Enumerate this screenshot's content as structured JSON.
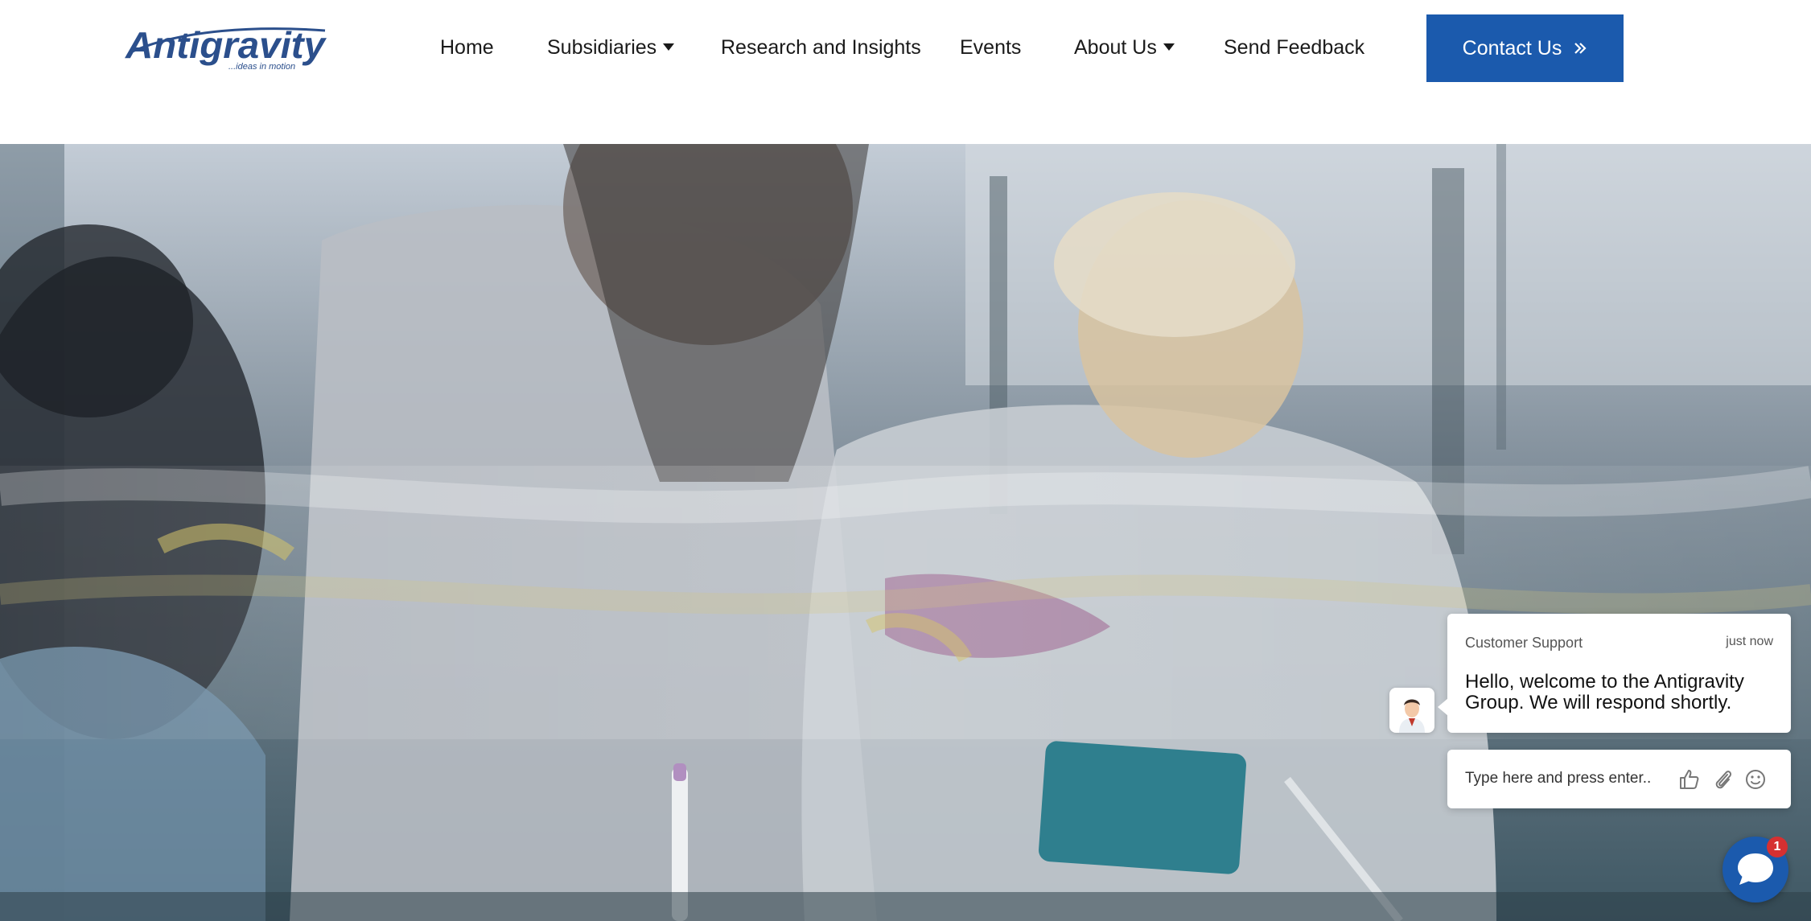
{
  "header": {
    "logo_text": "Antigravity",
    "logo_tagline": "...ideas in motion",
    "nav": [
      {
        "label": "Home"
      },
      {
        "label": "Subsidiaries",
        "has_dropdown": true
      },
      {
        "label": "Research and Insights"
      },
      {
        "label": "Events"
      },
      {
        "label": "About Us",
        "has_dropdown": true
      },
      {
        "label": "Send Feedback"
      }
    ],
    "contact_label": "Contact Us",
    "colors": {
      "accent": "#1b5aad",
      "logo": "#2b4f8c"
    }
  },
  "chat": {
    "sender": "Customer Support",
    "time": "just now",
    "message": "Hello, welcome to the Antigravity Group. We will respond shortly.",
    "input_placeholder": "Type here and press enter..",
    "icons": [
      "thumbs-up-icon",
      "paperclip-icon",
      "smiley-icon"
    ],
    "unread_count": "1"
  }
}
